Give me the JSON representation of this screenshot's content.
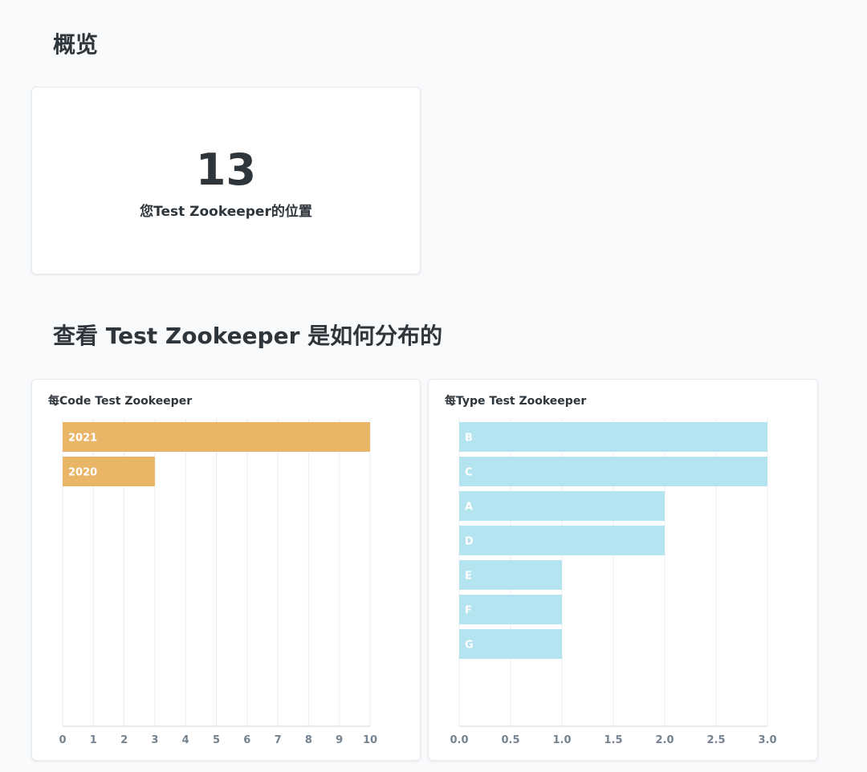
{
  "overview": {
    "heading": "概览",
    "scalar_value": "13",
    "scalar_label": "您Test Zookeeper的位置"
  },
  "distribution": {
    "heading": "查看 Test Zookeeper 是如何分布的"
  },
  "colors": {
    "code_bar": "#e9b667",
    "type_bar": "#b3e4ef",
    "grid": "#e9ecef",
    "axis": "#cfd6dc",
    "tick_text": "#74838f"
  },
  "chart_data": [
    {
      "type": "bar",
      "orientation": "horizontal",
      "title": "每Code Test Zookeeper",
      "categories": [
        "2021",
        "2020"
      ],
      "values": [
        10,
        3
      ],
      "xlim": [
        0,
        10
      ],
      "ticks": [
        0,
        1,
        2,
        3,
        4,
        5,
        6,
        7,
        8,
        9,
        10
      ],
      "tick_labels": [
        "0",
        "1",
        "2",
        "3",
        "4",
        "5",
        "6",
        "7",
        "8",
        "9",
        "10"
      ],
      "grid": true
    },
    {
      "type": "bar",
      "orientation": "horizontal",
      "title": "每Type Test Zookeeper",
      "categories": [
        "B",
        "C",
        "A",
        "D",
        "E",
        "F",
        "G"
      ],
      "values": [
        3,
        3,
        2,
        2,
        1,
        1,
        1
      ],
      "xlim": [
        0,
        3
      ],
      "ticks": [
        0,
        0.5,
        1,
        1.5,
        2,
        2.5,
        3
      ],
      "tick_labels": [
        "0.0",
        "0.5",
        "1.0",
        "1.5",
        "2.0",
        "2.5",
        "3.0"
      ],
      "grid": true
    }
  ]
}
